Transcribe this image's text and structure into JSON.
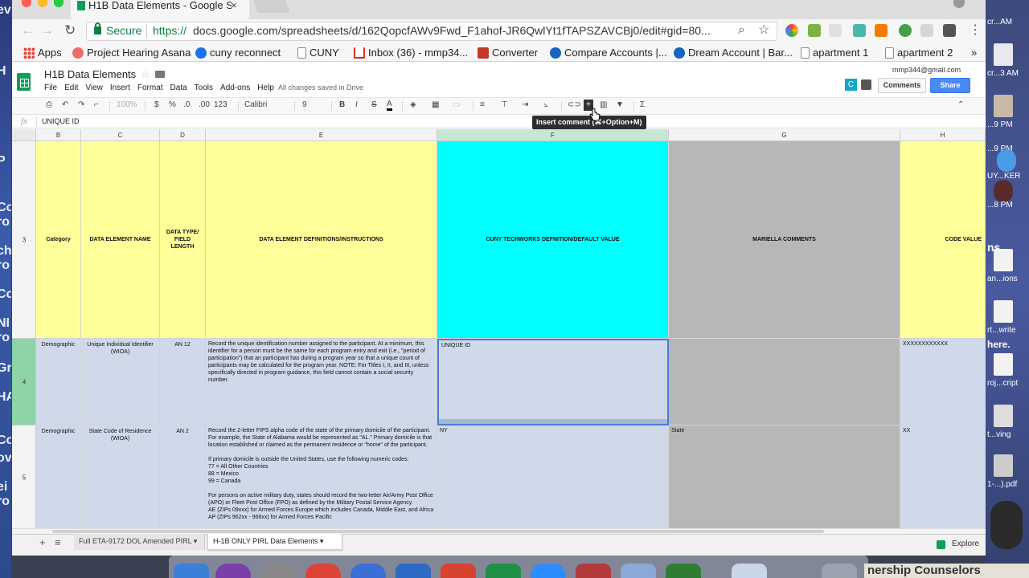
{
  "browser": {
    "tab_title": "H1B Data Elements - Google Sheets",
    "tab_close": "×",
    "secure_label": "Secure",
    "url_scheme": "https://",
    "url_rest": "docs.google.com/spreadsheets/d/162QopcfAWv9Fwd_F1ahof-JR6QwlYt1fTAPSZAVCBj0/edit#gid=80...",
    "bookmarks": [
      {
        "label": "Apps",
        "color": "#e94235"
      },
      {
        "label": "Project Hearing Asana",
        "color": "#f06a6a"
      },
      {
        "label": "cuny reconnect",
        "color": "#1a73e8"
      },
      {
        "label": "CUNY",
        "color": "#ffffff"
      },
      {
        "label": "Inbox (36) - mmp34...",
        "color": "#d93025"
      },
      {
        "label": "Converter",
        "color": "#c0392b"
      },
      {
        "label": "Compare Accounts |...",
        "color": "#1565c0"
      },
      {
        "label": "Dream Account | Bar...",
        "color": "#1565c0"
      },
      {
        "label": "apartment 1",
        "color": "#ffffff"
      },
      {
        "label": "apartment 2",
        "color": "#ffffff"
      }
    ],
    "bookmarks_overflow": "»"
  },
  "docs": {
    "title": "H1B Data Elements",
    "menu": [
      "File",
      "Edit",
      "View",
      "Insert",
      "Format",
      "Data",
      "Tools",
      "Add-ons",
      "Help"
    ],
    "save_status": "All changes saved in Drive",
    "account_email": "mmp344@gmail.com",
    "collaborator_initial": "C",
    "comments_label": "Comments",
    "share_label": "Share"
  },
  "format_toolbar": {
    "zoom": "100%",
    "currency": "$",
    "percent": "%",
    "dec_less": ".0",
    "dec_more": ".00",
    "more_formats": "123",
    "font_family": "Calibri",
    "font_size": "9",
    "bold": "B",
    "italic": "I",
    "strike": "S",
    "text_color": "A",
    "sum": "Σ"
  },
  "formula_bar": {
    "fx": "fx",
    "content": "UNIQUE ID"
  },
  "tooltip": "Insert comment (⌘+Option+M)",
  "grid": {
    "columns": [
      "B",
      "C",
      "D",
      "E",
      "F",
      "G",
      "H"
    ],
    "rows": [
      {
        "number": "3",
        "cells": [
          "Category",
          "DATA ELEMENT NAME",
          "DATA TYPE/ FIELD LENGTH",
          "DATA ELEMENT DEFINITIONS/INSTRUCTIONS",
          "CUNY TECHWORKS DEFNITION/DEFAULT VALUE",
          "MARIELLA COMMENTS",
          "CODE VALUE"
        ]
      },
      {
        "number": "4",
        "cells": [
          "Demographic",
          "Unique Individual Identifier (WIOA)",
          "AN 12",
          "Record the unique identification number assigned to the participant.  At a minimum, this identifier for a person must be the same for each program entry and exit (i.e., \"period of participation\") that an participant has during a program year so that a unique count of participants may be calculated for the program year.  NOTE: For Titles I, II, and III, unless specifically directed in program guidance, this field cannot contain a social security number.",
          "UNIQUE ID",
          "",
          "XXXXXXXXXXXX"
        ]
      },
      {
        "number": "5",
        "cells": [
          "Demographic",
          "State Code of Residence (WIOA)",
          "AN 2",
          "Record the 2-letter FIPS alpha code of the state of the primary domicile of the participant.  For example, the State of Alabama would be represented as \"AL.\"  Primary domicile is that location established or claimed as the permanent residence or \"home\" of the participant.\n\nIf primary domicile is outside the United States, use the following numeric codes:\n77 = All Other Countries\n88 = Mexico\n99 = Canada\n\nFor persons on active military duty, states should record the two-letter Air/Army Post Office (APO) or Fleet Post Office (FPO) as defined by the Military Postal Service Agency.\nAE (ZIPs 09xxx) for Armed Forces Europe which includes Canada, Middle East, and Africa\nAP (ZIPs 962xx - 966xx) for Armed Forces Pacific",
          "NY",
          "State",
          "XX"
        ]
      }
    ]
  },
  "sheets": {
    "add": "+",
    "list": "≡",
    "tabs": [
      "Full ETA-9172 DOL Amended PIRL",
      "H-1B ONLY PIRL Data Elements"
    ],
    "explore_label": "Explore"
  },
  "desktop": {
    "left_letters": [
      "ev",
      "H",
      "P",
      "Co",
      "ro",
      "ch",
      "ro",
      "Co",
      "NI",
      "ro",
      "Gra",
      "HA",
      "Co",
      "ov",
      "ei",
      "ro"
    ],
    "right_labels": [
      "cr...AM",
      "cr...3 AM",
      "...9 PM",
      "...9 PM",
      "UY...KER",
      "...8 PM",
      "ns",
      "an...ions",
      "rt...write",
      "here.",
      "roj...cript",
      "t...ving",
      "1-...).pdf"
    ],
    "dock_banner": "nership Counselors"
  },
  "colors": {
    "yellow_header": "#ffff99",
    "cyan_header": "#00ffff",
    "gray_column": "#b7b7b7",
    "light_blue_cell": "#cfd9ea",
    "selected_row_header": "#8fd4a8"
  }
}
